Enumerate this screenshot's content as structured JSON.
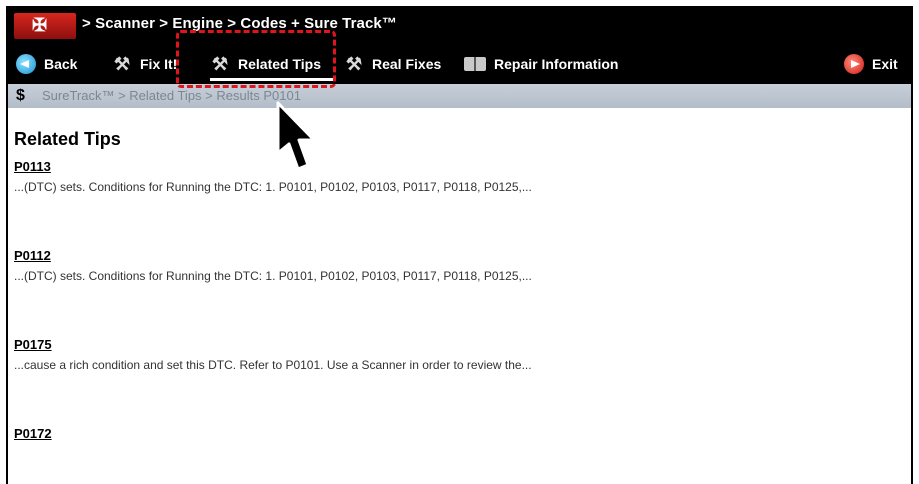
{
  "titlebar": {
    "breadcrumb": "> Scanner  > Engine  > Codes + Sure Track™"
  },
  "toolbar": {
    "back": "Back",
    "fix_it": "Fix It!",
    "related_tips": "Related Tips",
    "real_fixes": "Real Fixes",
    "repair_info": "Repair Information",
    "exit": "Exit"
  },
  "pathbar": {
    "path": "SureTrack™ > Related Tips > Results P0101"
  },
  "main": {
    "title": "Related Tips",
    "results": [
      {
        "code": "P0113",
        "snippet": "...(DTC) sets. Conditions for Running the DTC: 1. P0101, P0102, P0103, P0117, P0118, P0125,..."
      },
      {
        "code": "P0112",
        "snippet": "...(DTC) sets. Conditions for Running the DTC: 1. P0101, P0102, P0103, P0117, P0118, P0125,..."
      },
      {
        "code": "P0175",
        "snippet": "...cause a rich condition and set this DTC. Refer to P0101. Use a Scanner in order to review the..."
      },
      {
        "code": "P0172",
        "snippet": ""
      }
    ]
  },
  "colors": {
    "callout": "#e0141b",
    "toolbar_bg": "#000000",
    "pathbar_bg": "#b8c2ce"
  }
}
